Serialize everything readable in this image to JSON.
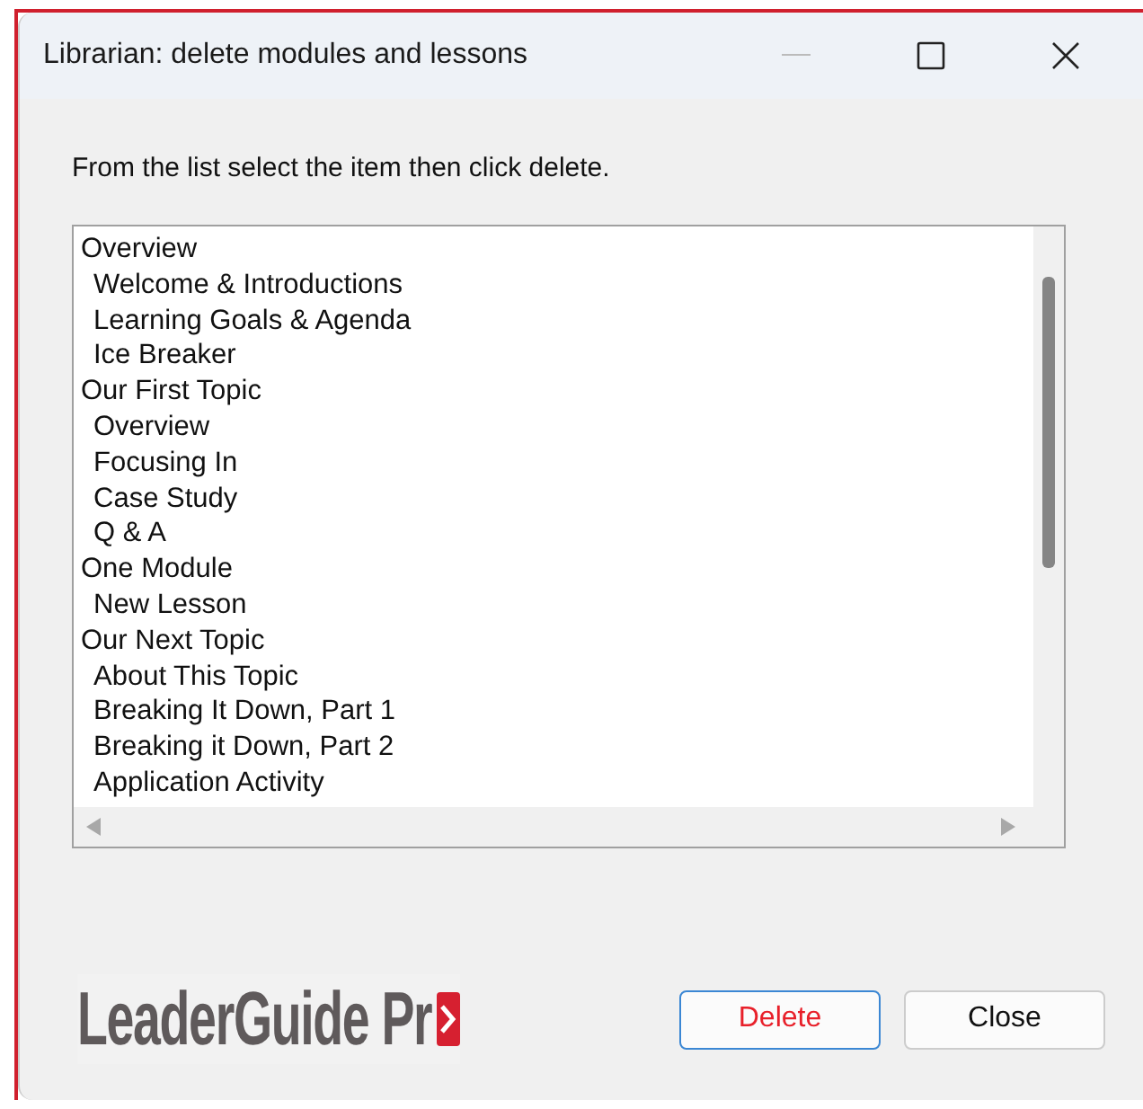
{
  "window": {
    "title": "Librarian: delete modules and lessons"
  },
  "instruction": "From the list select the item then click delete.",
  "list": {
    "items": [
      {
        "label": "Overview",
        "children": [
          {
            "label": "Welcome & Introductions"
          },
          {
            "label": "Learning Goals & Agenda"
          },
          {
            "label": "Ice Breaker"
          }
        ]
      },
      {
        "label": "Our First Topic",
        "children": [
          {
            "label": "Overview"
          },
          {
            "label": "Focusing In"
          },
          {
            "label": "Case Study"
          },
          {
            "label": "Q & A"
          }
        ]
      },
      {
        "label": "One Module",
        "children": [
          {
            "label": "New Lesson"
          }
        ]
      },
      {
        "label": "Our Next Topic",
        "children": [
          {
            "label": "About This Topic"
          },
          {
            "label": "Breaking It Down, Part 1"
          },
          {
            "label": "Breaking it Down, Part 2"
          },
          {
            "label": "Application Activity"
          }
        ]
      }
    ]
  },
  "logo": {
    "text": "LeaderGuide Pr"
  },
  "buttons": [
    {
      "label": "Delete",
      "kind": "danger"
    },
    {
      "label": "Close",
      "kind": "normal"
    }
  ]
}
